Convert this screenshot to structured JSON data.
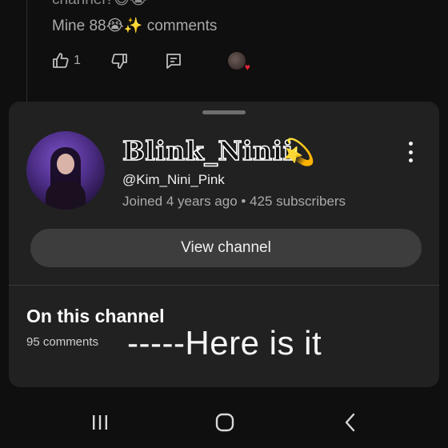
{
  "background_comment": {
    "partial_text": "channel?😅😭",
    "text": "Mine 88😭✨ comments",
    "like_count": "1",
    "icons": [
      "thumbs-up-icon",
      "thumbs-down-icon",
      "reply-icon",
      "creator-heart-icon"
    ]
  },
  "channel_sheet": {
    "name": "Blink_Ninii",
    "name_emoji": "💫",
    "handle": "@Kim_Nini_Pink",
    "meta": "Joined 4 years ago • 425 subscribers",
    "view_channel_label": "View channel",
    "section_title": "On this channel",
    "comments_count": "95 comments",
    "annotation": "-----Here is it",
    "icons": [
      "more-vert-icon"
    ]
  },
  "system_nav": {
    "icons": [
      "recents-icon",
      "home-icon",
      "back-icon"
    ]
  }
}
